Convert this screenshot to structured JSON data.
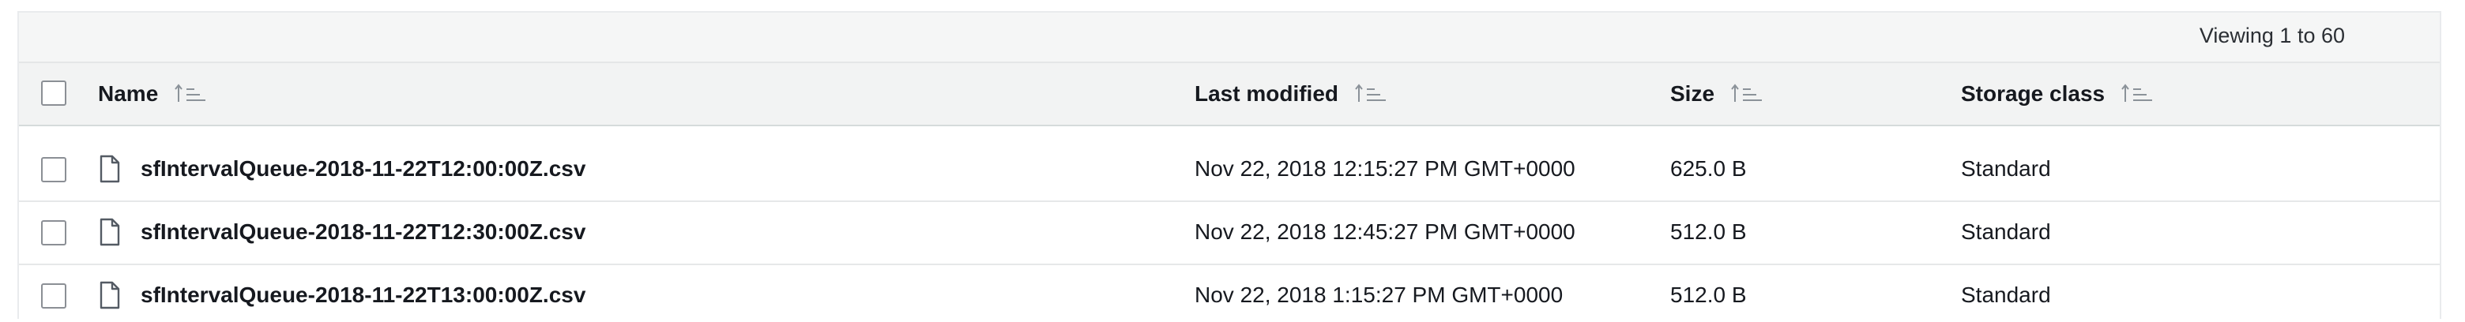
{
  "pagination": {
    "text": "Viewing 1 to 60"
  },
  "columns": {
    "name": "Name",
    "last_modified": "Last modified",
    "size": "Size",
    "storage_class": "Storage class"
  },
  "rows": [
    {
      "name": "sfIntervalQueue-2018-11-22T12:00:00Z.csv",
      "last_modified": "Nov 22, 2018 12:15:27 PM GMT+0000",
      "size": "625.0 B",
      "storage_class": "Standard"
    },
    {
      "name": "sfIntervalQueue-2018-11-22T12:30:00Z.csv",
      "last_modified": "Nov 22, 2018 12:45:27 PM GMT+0000",
      "size": "512.0 B",
      "storage_class": "Standard"
    },
    {
      "name": "sfIntervalQueue-2018-11-22T13:00:00Z.csv",
      "last_modified": "Nov 22, 2018 1:15:27 PM GMT+0000",
      "size": "512.0 B",
      "storage_class": "Standard"
    }
  ],
  "icons": {
    "sort": "sort-ascending-icon",
    "file": "file-icon"
  }
}
